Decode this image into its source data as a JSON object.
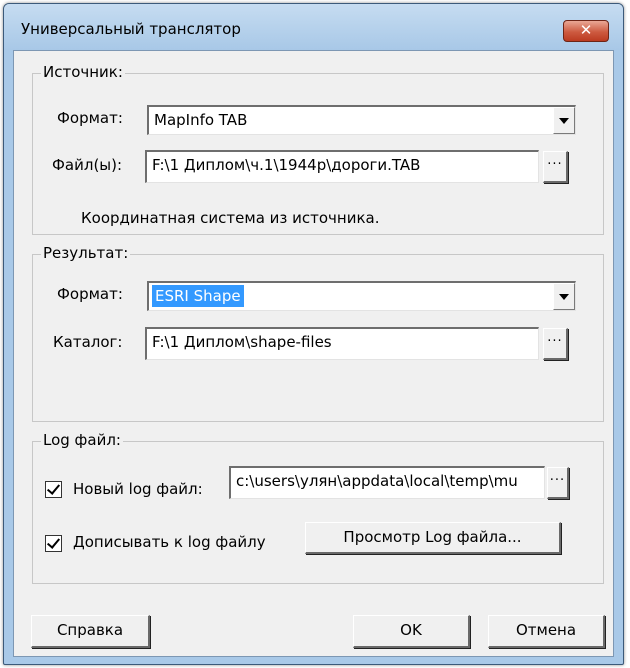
{
  "window": {
    "title": "Универсальный транслятор",
    "close_glyph": "✕"
  },
  "source": {
    "legend": "Источник:",
    "format_label": "Формат:",
    "format_value": "MapInfo TAB",
    "files_label": "Файл(ы):",
    "files_value": "F:\\1 Диплом\\ч.1\\1944р\\дороги.TAB",
    "browse_label": "...",
    "coord_note": "Координатная система из источника."
  },
  "result": {
    "legend": "Результат:",
    "format_label": "Формат:",
    "format_value": "ESRI Shape",
    "catalog_label": "Каталог:",
    "catalog_value": "F:\\1 Диплом\\shape-files",
    "browse_label": "..."
  },
  "log": {
    "legend": "Log файл:",
    "new_log_label": "Новый log файл:",
    "new_log_checked": true,
    "new_log_path": "c:\\users\\улян\\appdata\\local\\temp\\mu",
    "browse_label": "...",
    "append_label": "Дописывать к log файлу",
    "append_checked": true,
    "view_button": "Просмотр Log файла..."
  },
  "footer": {
    "help_button": "Справка",
    "ok_button": "OK",
    "cancel_button": "Отмена"
  }
}
